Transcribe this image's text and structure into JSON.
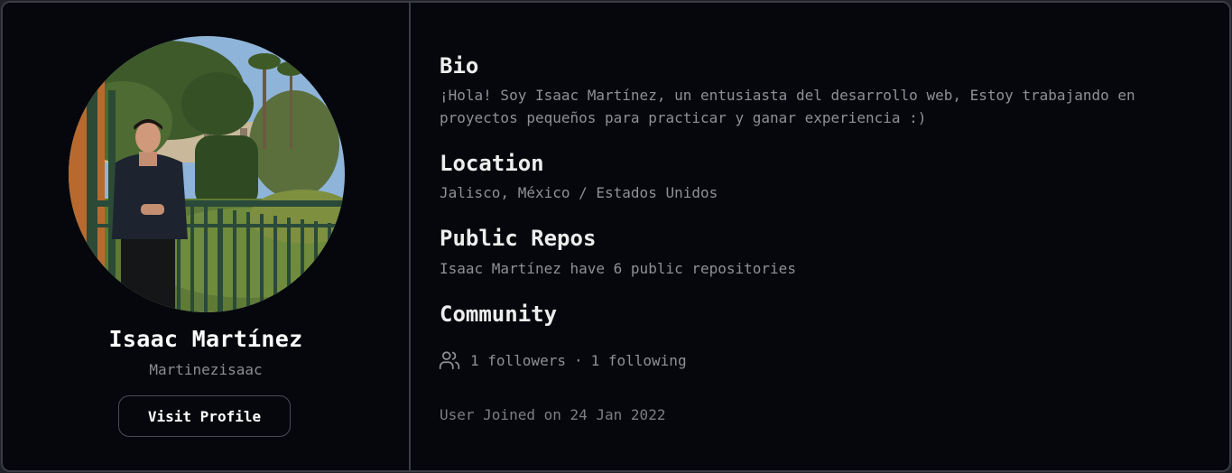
{
  "profile": {
    "name": "Isaac Martínez",
    "username": "Martinezisaac",
    "visit_label": "Visit Profile"
  },
  "bio": {
    "title": "Bio",
    "text": "¡Hola! Soy Isaac Martínez, un entusiasta del desarrollo web, Estoy trabajando en proyectos pequeños para practicar y ganar experiencia :)"
  },
  "location": {
    "title": "Location",
    "text": "Jalisco, México / Estados Unidos"
  },
  "repos": {
    "title": "Public Repos",
    "text": "Isaac Martínez have 6 public repositories"
  },
  "community": {
    "title": "Community",
    "followers": "1 followers",
    "separator": "·",
    "following": "1 following",
    "icon": "users-icon"
  },
  "joined": "User Joined on 24 Jan 2022"
}
